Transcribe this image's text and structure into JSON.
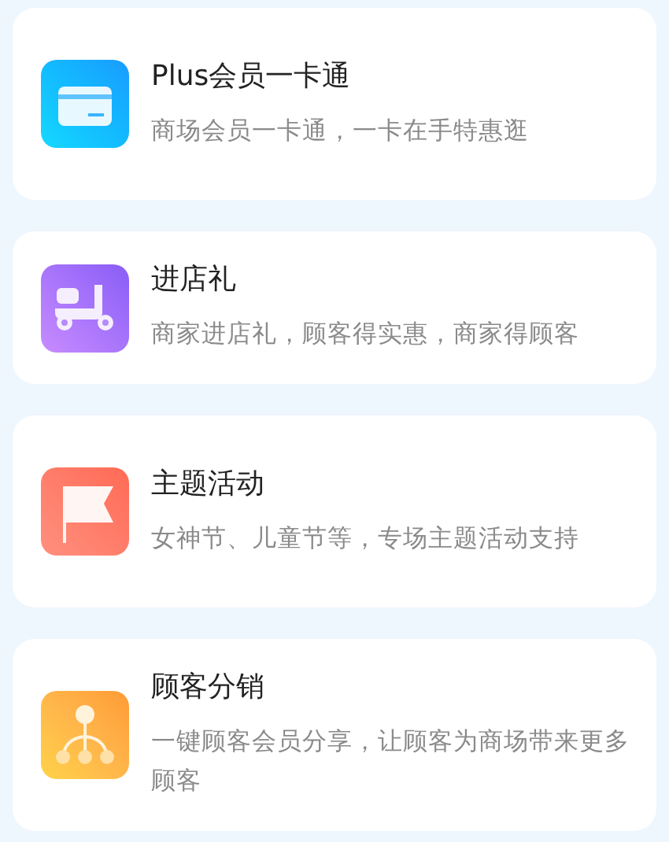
{
  "features": [
    {
      "kind": "card",
      "title": "Plus会员一卡通",
      "description": "商场会员一卡通，一卡在手特惠逛"
    },
    {
      "kind": "scooter",
      "title": "进店礼",
      "description": "商家进店礼，顾客得实惠，商家得顾客"
    },
    {
      "kind": "flag",
      "title": "主题活动",
      "description": "女神节、儿童节等，专场主题活动支持"
    },
    {
      "kind": "share",
      "title": "顾客分销",
      "description": "一键顾客会员分享，让顾客为商场带来更多顾客"
    }
  ]
}
